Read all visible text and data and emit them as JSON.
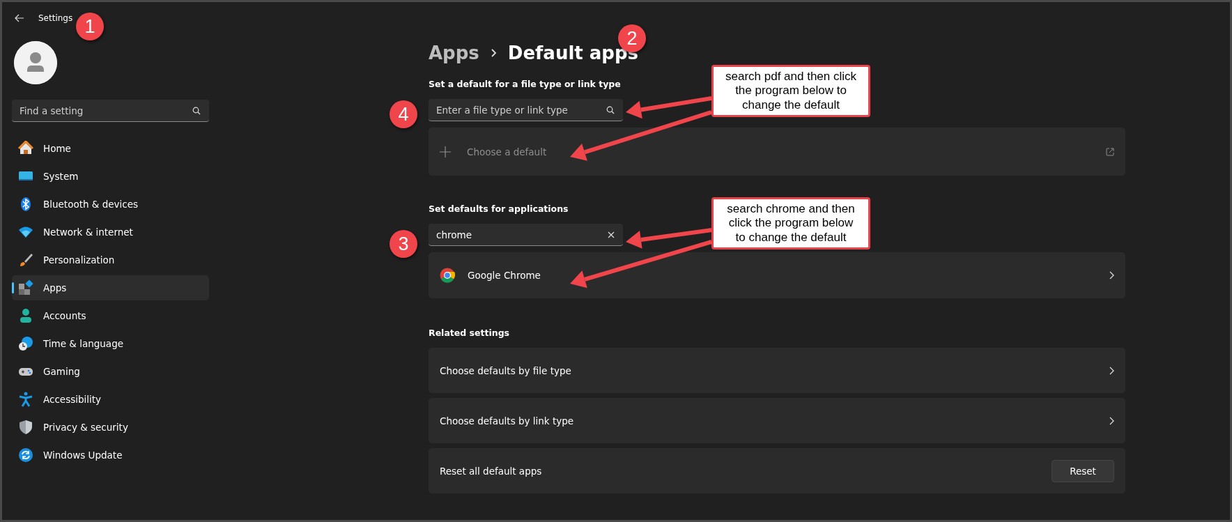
{
  "window": {
    "title": "Settings"
  },
  "sidebar": {
    "search": {
      "placeholder": "Find a setting"
    },
    "items": [
      {
        "label": "Home",
        "selected": false
      },
      {
        "label": "System",
        "selected": false
      },
      {
        "label": "Bluetooth & devices",
        "selected": false
      },
      {
        "label": "Network & internet",
        "selected": false
      },
      {
        "label": "Personalization",
        "selected": false
      },
      {
        "label": "Apps",
        "selected": true
      },
      {
        "label": "Accounts",
        "selected": false
      },
      {
        "label": "Time & language",
        "selected": false
      },
      {
        "label": "Gaming",
        "selected": false
      },
      {
        "label": "Accessibility",
        "selected": false
      },
      {
        "label": "Privacy & security",
        "selected": false
      },
      {
        "label": "Windows Update",
        "selected": false
      }
    ]
  },
  "breadcrumb": [
    {
      "label": "Apps",
      "current": false
    },
    {
      "label": "Default apps",
      "current": true
    }
  ],
  "file_type_section": {
    "heading": "Set a default for a file type or link type",
    "search": {
      "placeholder": "Enter a file type or link type"
    },
    "choose_default": {
      "label": "Choose a default",
      "disabled": true
    }
  },
  "apps_section": {
    "heading": "Set defaults for applications",
    "search": {
      "value": "chrome"
    },
    "results": [
      {
        "label": "Google Chrome"
      }
    ]
  },
  "related_section": {
    "heading": "Related settings",
    "rows": [
      {
        "kind": "link",
        "label": "Choose defaults by file type"
      },
      {
        "kind": "link",
        "label": "Choose defaults by link type"
      },
      {
        "kind": "button",
        "label": "Reset all default apps",
        "button": "Reset"
      }
    ]
  },
  "annotations": {
    "badges": [
      "1",
      "2",
      "4",
      "3"
    ],
    "callouts": [
      {
        "text": "search pdf and then click the program below to change the default"
      },
      {
        "text": "search chrome and then click the program below to change the default"
      }
    ]
  }
}
